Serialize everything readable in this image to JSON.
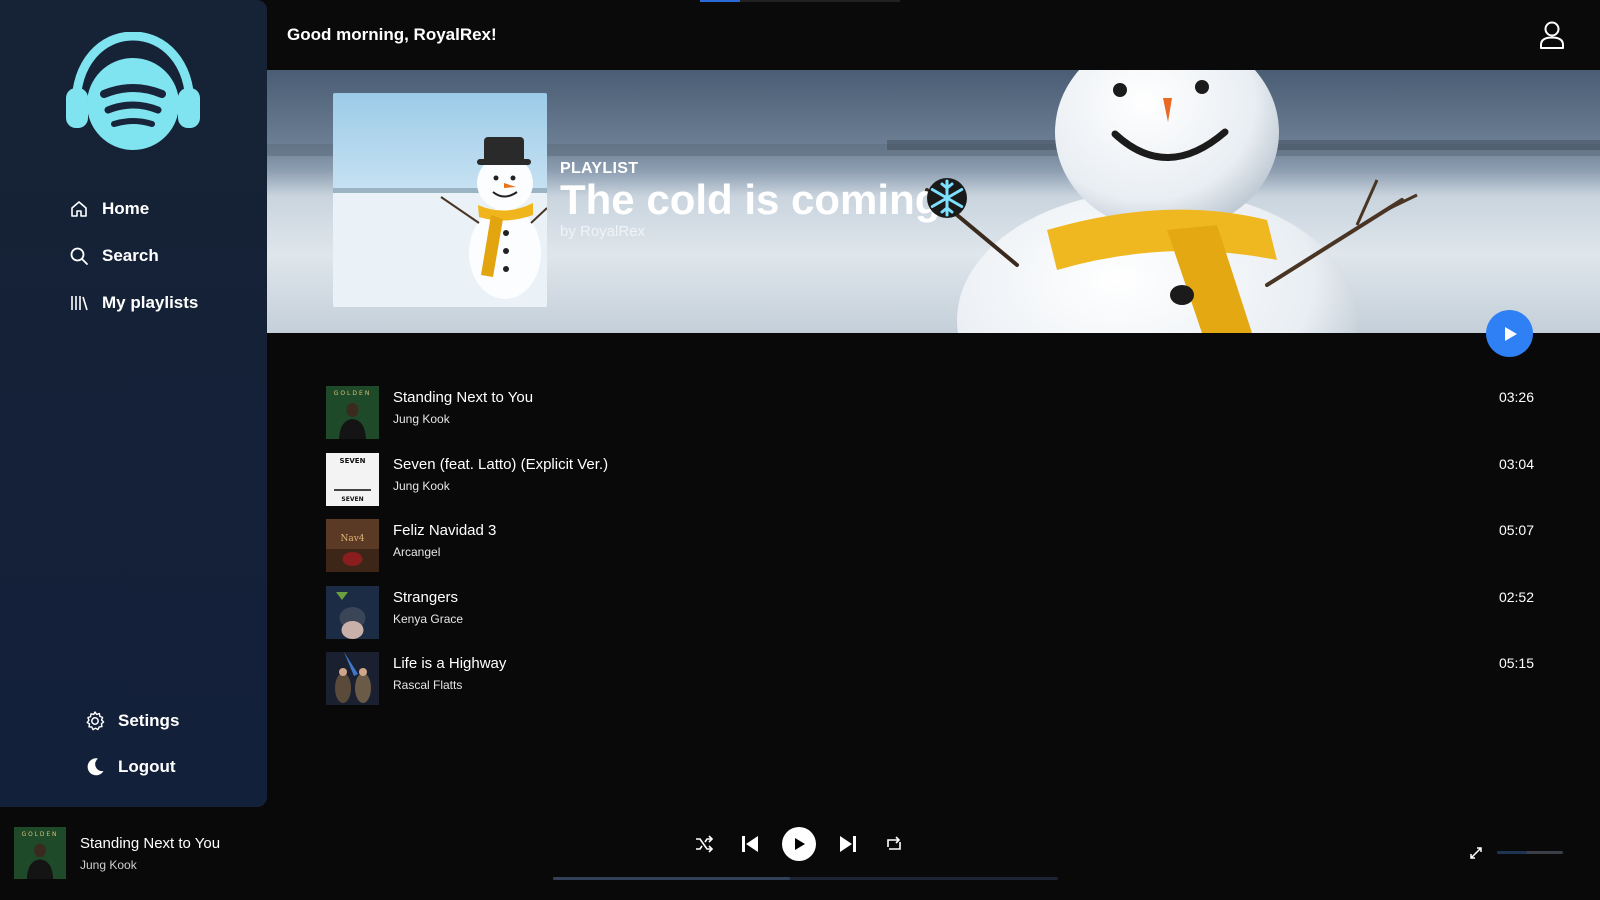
{
  "app": {
    "accent": "#2f7ff5",
    "logo_color": "#7fe3f0"
  },
  "sidebar": {
    "items": [
      {
        "label": "Home",
        "icon": "home-icon"
      },
      {
        "label": "Search",
        "icon": "search-icon"
      },
      {
        "label": "My playlists",
        "icon": "library-icon"
      }
    ],
    "bottom_items": [
      {
        "label": "Setings",
        "icon": "gear-icon"
      },
      {
        "label": "Logout",
        "icon": "moon-icon"
      }
    ]
  },
  "header": {
    "greeting": "Good morning, RoyalRex!",
    "user_icon": "user-icon"
  },
  "playlist": {
    "type_label": "PLAYLIST",
    "title": "The cold is coming",
    "owner": "by RoyalRex",
    "title_icon": "snowflake-icon"
  },
  "tracks": [
    {
      "title": "Standing Next to You",
      "artist": "Jung Kook",
      "duration": "03:26"
    },
    {
      "title": "Seven (feat. Latto) (Explicit Ver.)",
      "artist": "Jung Kook",
      "duration": "03:04"
    },
    {
      "title": "Feliz Navidad 3",
      "artist": "Arcangel",
      "duration": "05:07"
    },
    {
      "title": "Strangers",
      "artist": "Kenya Grace",
      "duration": "02:52"
    },
    {
      "title": "Life is a Highway",
      "artist": "Rascal Flatts",
      "duration": "05:15"
    }
  ],
  "player": {
    "now_playing_title": "Standing Next to You",
    "now_playing_artist": "Jung Kook",
    "progress_fraction": 0.47,
    "volume_fraction": 0.45
  }
}
